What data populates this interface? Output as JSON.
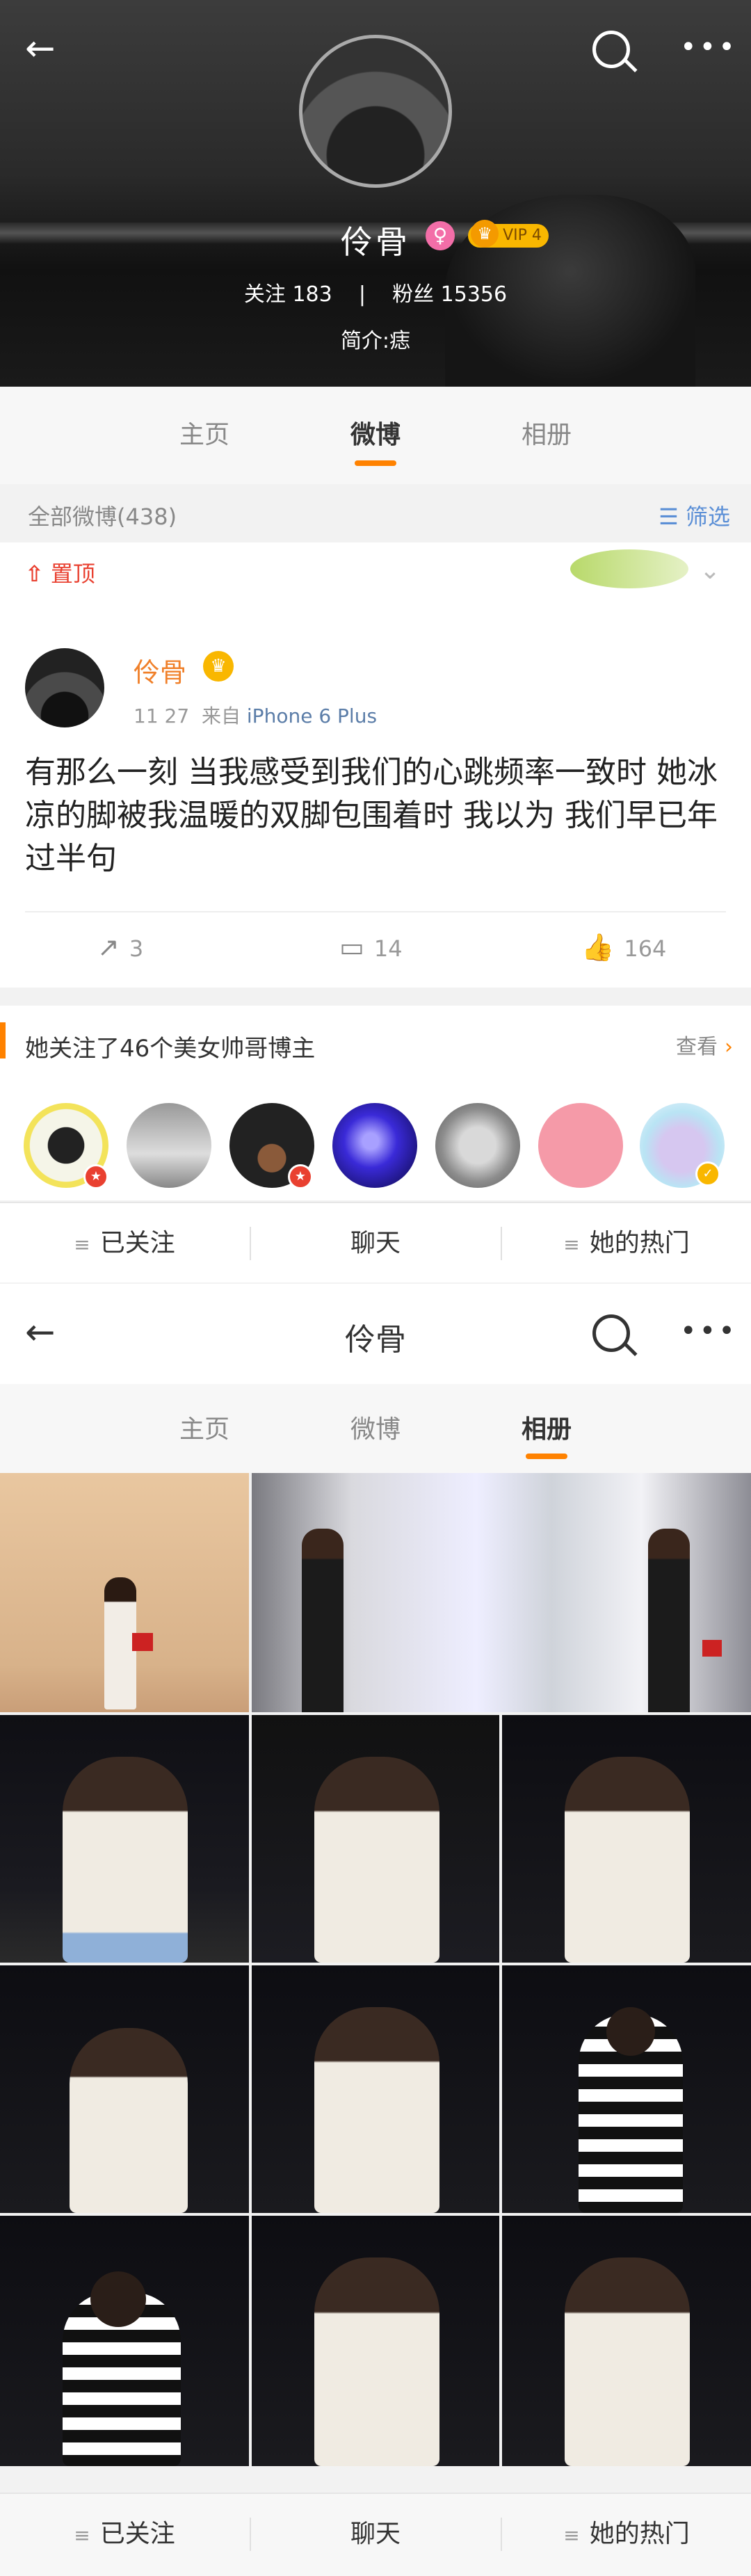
{
  "header": {
    "profile_name": "伶骨",
    "female_icon": "♀",
    "vip_label": "VIP 4",
    "crown_icon": "♛",
    "following_label": "关注",
    "following_count": "183",
    "separator": "|",
    "followers_label": "粉丝",
    "followers_count": "15356",
    "bio": "简介:痣"
  },
  "icons": {
    "back": "←",
    "search": "○",
    "more": "•••"
  },
  "tabs": [
    "主页",
    "微博",
    "相册"
  ],
  "filter": {
    "all_posts": "全部微博(438)",
    "filter_label": "筛选",
    "filter_icon": "☰"
  },
  "post": {
    "pin_icon": "⇧",
    "pin_label": "置顶",
    "author": "伶骨",
    "time": "11  27",
    "source_prefix": "来自",
    "source": "iPhone 6 Plus",
    "text": "有那么一刻  当我感受到我们的心跳频率一致时  她冰凉的脚被我温暖的双脚包围着时  我以为  我们早已年过半句",
    "reposts": "3",
    "comments": "14",
    "likes": "164",
    "repost_icon": "↗",
    "comment_icon": "▭",
    "like_icon": "👍"
  },
  "recommend": {
    "title": "她关注了46个美女帅哥博主",
    "more": "查看",
    "more_icon": "›"
  },
  "bottom_bar": {
    "lines_icon": "≡",
    "followed": "已关注",
    "chat": "聊天",
    "hot": "她的热门"
  },
  "album_header": {
    "title": "伶骨"
  },
  "colors": {
    "accent": "#ff8200",
    "pin": "#e94030",
    "link": "#5b8fd6"
  }
}
